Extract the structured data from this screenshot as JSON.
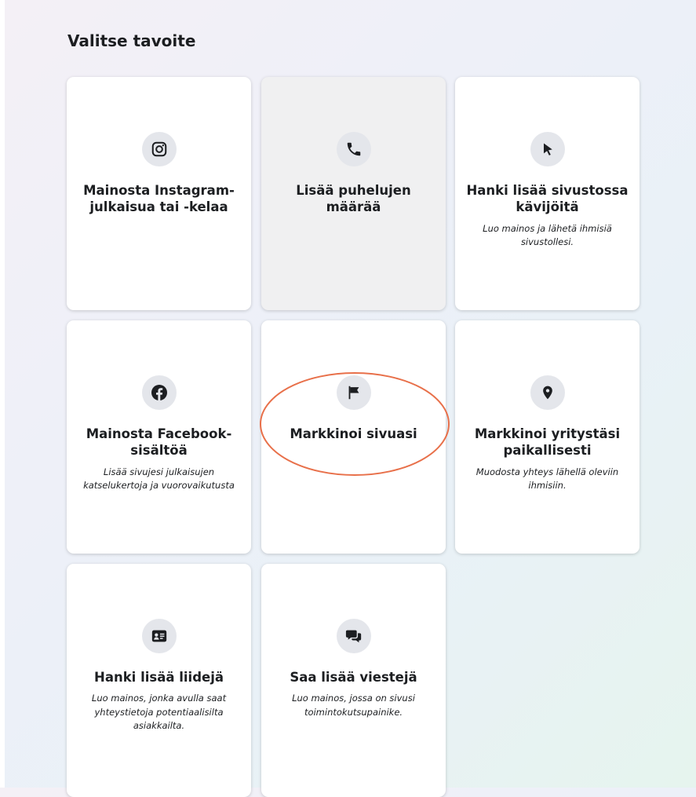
{
  "page": {
    "title": "Valitse tavoite"
  },
  "cards": [
    {
      "icon": "instagram-icon",
      "title": "Mainosta Instagram-julkaisua tai -kelaa",
      "description": ""
    },
    {
      "icon": "phone-icon",
      "title": "Lisää puhelujen määrää",
      "description": ""
    },
    {
      "icon": "cursor-icon",
      "title": "Hanki lisää sivustossa kävijöitä",
      "description": "Luo mainos ja lähetä ihmisiä sivustollesi."
    },
    {
      "icon": "facebook-icon",
      "title": "Mainosta Facebook-sisältöä",
      "description": "Lisää sivujesi julkaisujen katselukertoja ja vuorovaikutusta"
    },
    {
      "icon": "flag-icon",
      "title": "Markkinoi sivuasi",
      "description": ""
    },
    {
      "icon": "location-pin-icon",
      "title": "Markkinoi yritystäsi paikallisesti",
      "description": "Muodosta yhteys lähellä oleviin ihmisiin."
    },
    {
      "icon": "lead-card-icon",
      "title": "Hanki lisää liidejä",
      "description": "Luo mainos, jonka avulla saat yhteystietoja potentiaalisilta asiakkailta."
    },
    {
      "icon": "chat-bubbles-icon",
      "title": "Saa lisää viestejä",
      "description": "Luo mainos, jossa on sivusi toimintokutsupainike."
    }
  ],
  "colors": {
    "annotation": "#e8704a",
    "icon": "#1c1e21",
    "icon_bg": "#e4e6eb",
    "selected_card": "#f0f0f1"
  }
}
